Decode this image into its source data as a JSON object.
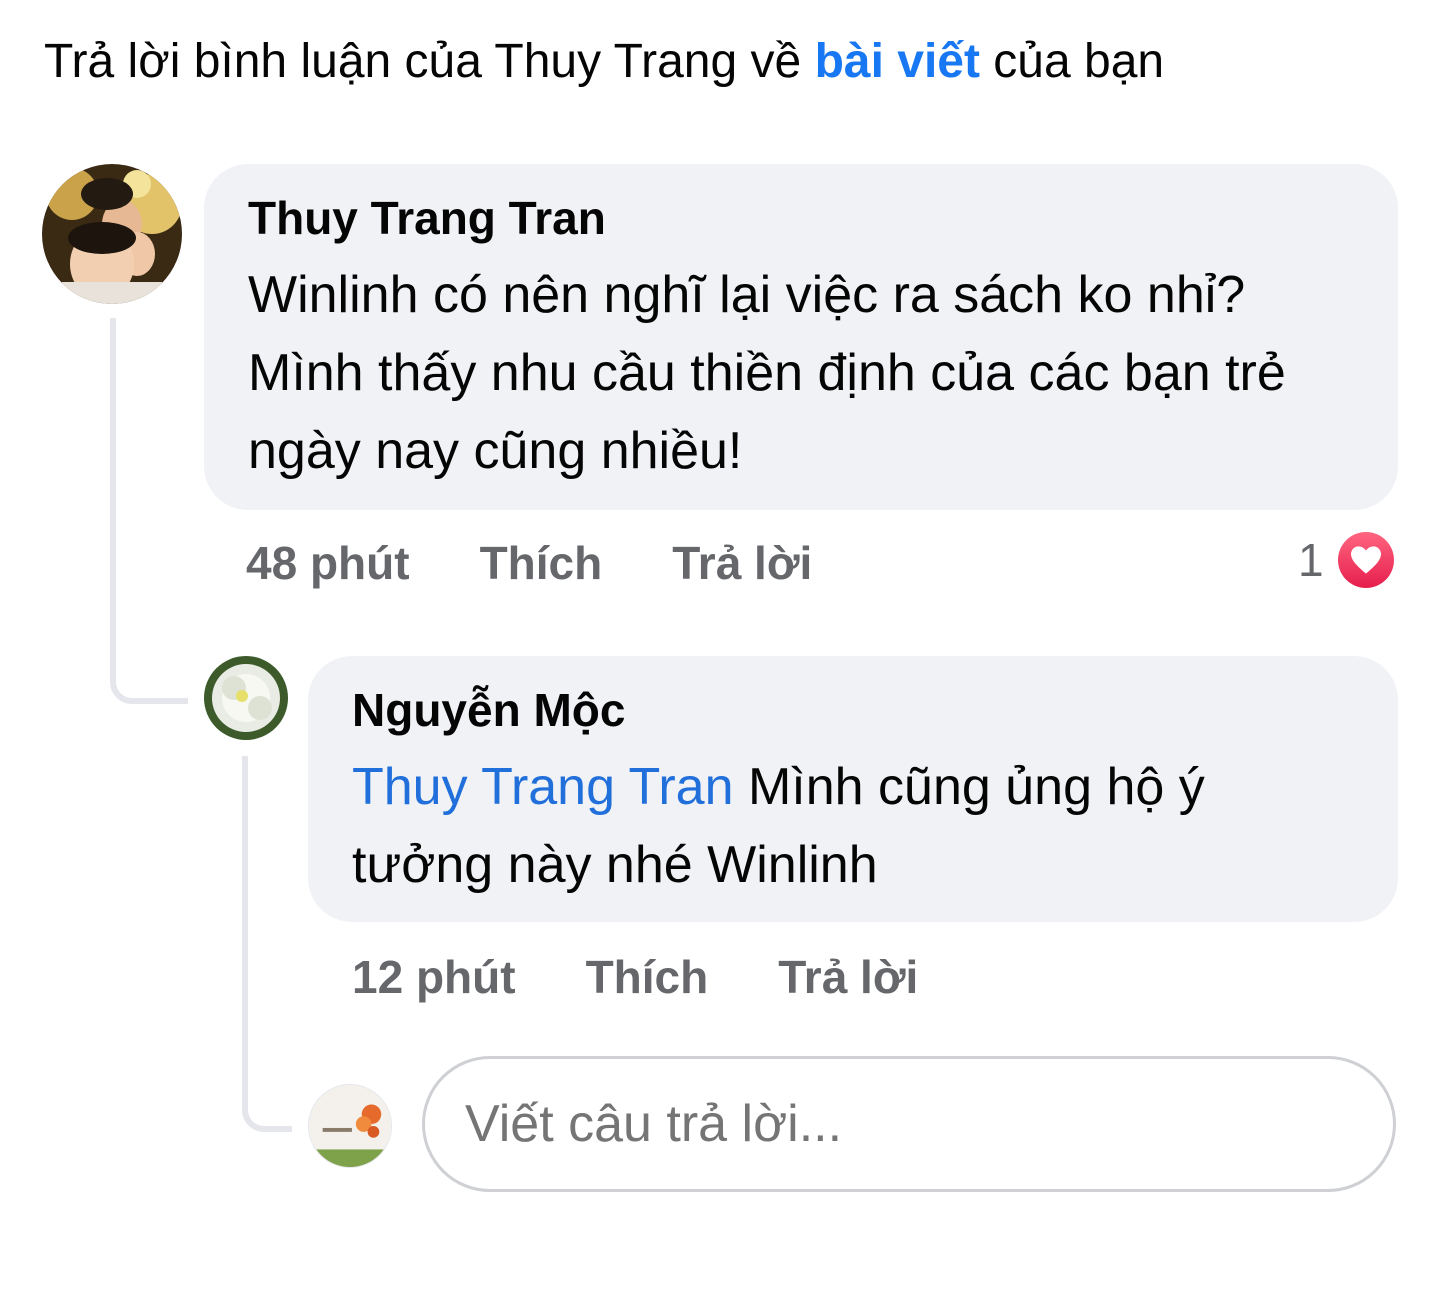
{
  "notification": {
    "prefix": "Trả lời bình luận của Thuy Trang về ",
    "link": "bài viết",
    "suffix": " của bạn"
  },
  "comment": {
    "author": "Thuy Trang Tran",
    "text": "Winlinh có nên nghĩ lại việc ra sách ko nhỉ? Mình thấy nhu cầu thiền định của các bạn trẻ ngày nay cũng nhiều!",
    "time": "48 phút",
    "like_label": "Thích",
    "reply_label": "Trả lời",
    "reaction_count": "1"
  },
  "reply": {
    "author": "Nguyễn Mộc",
    "mention": "Thuy Trang Tran",
    "text": " Mình cũng ủng hộ ý tưởng này nhé Winlinh",
    "time": "12 phút",
    "like_label": "Thích",
    "reply_label": "Trả lời"
  },
  "composer": {
    "placeholder": "Viết câu trả lời..."
  },
  "colors": {
    "accent": "#1877f2",
    "mention": "#216fdb",
    "bubble": "#f0f2f5",
    "meta": "#65676b",
    "reaction": "#e61e4d"
  },
  "icons": [
    "heart-icon"
  ]
}
